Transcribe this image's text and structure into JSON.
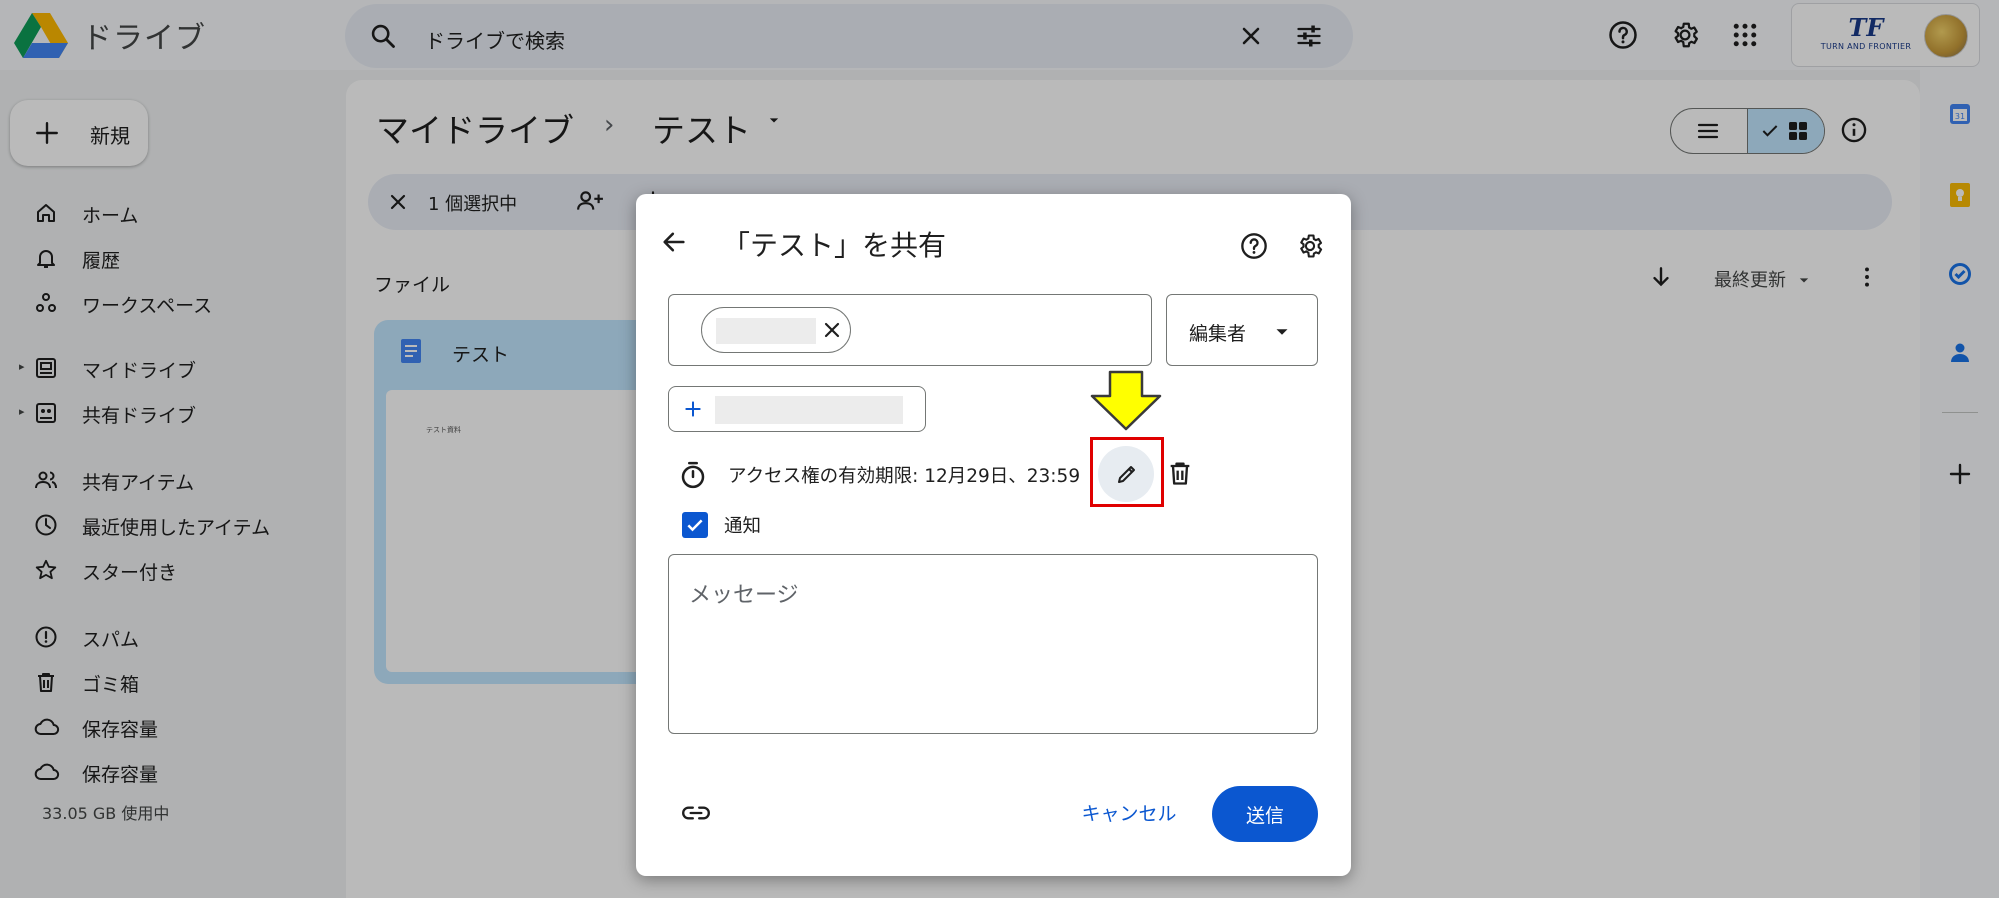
{
  "app": {
    "title": "ドライブ"
  },
  "search": {
    "text": "ドライブで検索"
  },
  "org_badge": {
    "logo_text": "TF",
    "name": "TURN AND FRONTIER"
  },
  "sidebar": {
    "new_label": "新規",
    "items": [
      {
        "label": "ホーム",
        "icon": "home-icon"
      },
      {
        "label": "履歴",
        "icon": "bell-icon"
      },
      {
        "label": "ワークスペース",
        "icon": "workspace-icon"
      },
      {
        "label": "マイドライブ",
        "icon": "my-drive-icon"
      },
      {
        "label": "共有ドライブ",
        "icon": "shared-drive-icon"
      },
      {
        "label": "共有アイテム",
        "icon": "people-icon"
      },
      {
        "label": "最近使用したアイテム",
        "icon": "clock-icon"
      },
      {
        "label": "スター付き",
        "icon": "star-icon"
      },
      {
        "label": "スパム",
        "icon": "spam-icon"
      },
      {
        "label": "ゴミ箱",
        "icon": "trash-icon"
      },
      {
        "label": "保存容量",
        "icon": "cloud-icon"
      },
      {
        "label": "保存容量",
        "icon": "cloud-icon"
      }
    ],
    "storage_used": "33.05 GB 使用中"
  },
  "main": {
    "breadcrumb_root": "マイドライブ",
    "breadcrumb_sep": "›",
    "breadcrumb_current": "テスト",
    "selection_count": "1 個選択中",
    "files_heading": "ファイル",
    "sort_label": "最終更新",
    "file": {
      "name": "テスト",
      "thumb_text": "テスト資料"
    }
  },
  "dialog": {
    "title": "「テスト」を共有",
    "role": "編集者",
    "expiry": "アクセス権の有効期限: 12月29日、23:59",
    "notify_label": "通知",
    "notify_checked": true,
    "message_placeholder": "メッセージ",
    "cancel_label": "キャンセル",
    "send_label": "送信"
  },
  "annotation": {
    "arrow_color": "#ffff00",
    "highlight_color": "#e00000"
  },
  "colors": {
    "accent": "#0b57d0",
    "selected_bg": "#c2e7ff"
  }
}
